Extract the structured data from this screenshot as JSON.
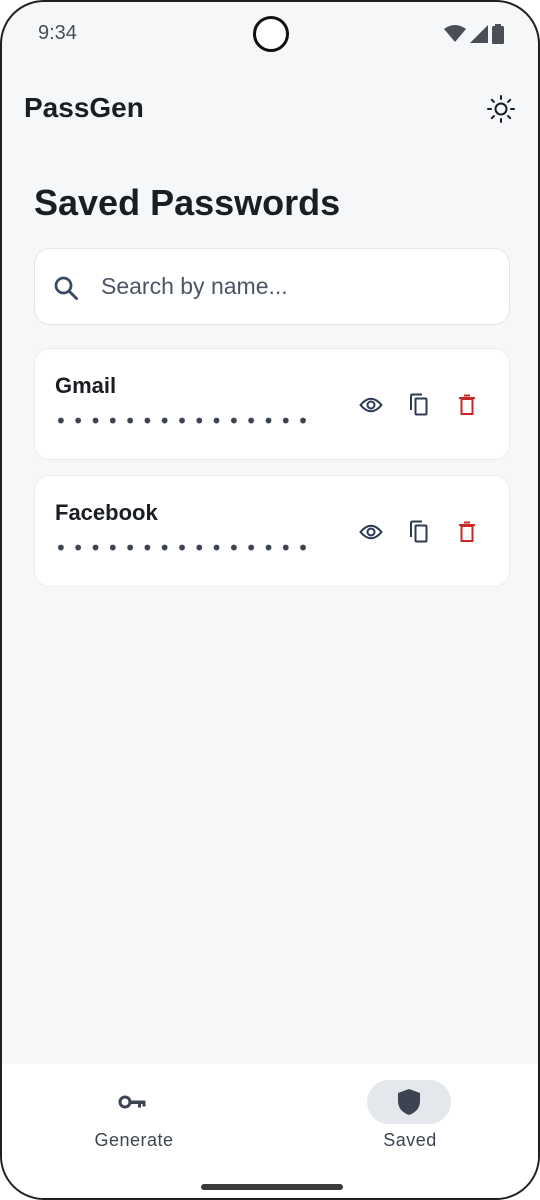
{
  "status_bar": {
    "time": "9:34"
  },
  "app": {
    "title": "PassGen",
    "theme_icon": "sun-icon"
  },
  "page": {
    "title": "Saved Passwords"
  },
  "search": {
    "placeholder": "Search by name...",
    "value": ""
  },
  "passwords": [
    {
      "name": "Gmail",
      "masked": "•••••••••••••••"
    },
    {
      "name": "Facebook",
      "masked": "•••••••••••••••"
    }
  ],
  "actions": {
    "view_icon": "eye-icon",
    "copy_icon": "copy-icon",
    "delete_icon": "trash-icon"
  },
  "colors": {
    "delete": "#c62828",
    "accent_bg": "#e4e7ec",
    "text": "#1a1d24",
    "background": "#f6f7f9"
  },
  "nav": {
    "items": [
      {
        "label": "Generate",
        "icon": "key-icon",
        "active": false
      },
      {
        "label": "Saved",
        "icon": "shield-icon",
        "active": true
      }
    ]
  }
}
